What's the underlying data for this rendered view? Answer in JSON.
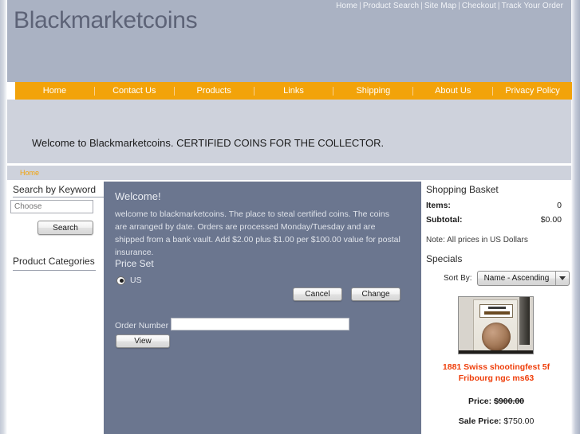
{
  "topnav": {
    "links": [
      "Home",
      "Product Search",
      "Site Map",
      "Checkout",
      "Track Your Order"
    ],
    "separator": "|"
  },
  "brand": {
    "title": "Blackmarketcoins"
  },
  "mainnav": {
    "items": [
      "Home",
      "Contact Us",
      "Products",
      "Links",
      "Shipping",
      "About Us",
      "Privacy Policy"
    ]
  },
  "banner": {
    "text": "Welcome to Blackmarketcoins. CERTIFIED COINS FOR THE COLLECTOR."
  },
  "breadcrumb": {
    "current": "Home"
  },
  "sidebar_left": {
    "search_heading": "Search by Keyword",
    "search_placeholder": "Choose",
    "search_value": "",
    "search_button": "Search",
    "categories_heading": "Product Categories"
  },
  "main": {
    "heading": "Welcome!",
    "body": "welcome to blackmarketcoins. The place to steal certified coins. The coins are arranged by date. Orders are processed Monday/Tuesday and are shipped from a bank vault. Add $2.00 plus $1.00 per $100.00 value for postal insurance.",
    "price_set_heading": "Price Set",
    "price_set_option": "US",
    "cancel_button": "Cancel",
    "change_button": "Change",
    "order_number_label": "Order Number",
    "order_number_value": "",
    "view_button": "View"
  },
  "sidebar_right": {
    "basket_heading": "Shopping Basket",
    "items_label": "Items:",
    "items_value": "0",
    "subtotal_label": "Subtotal:",
    "subtotal_value": "$0.00",
    "note": "Note: All prices in US Dollars",
    "specials_heading": "Specials",
    "sort_label": "Sort By:",
    "sort_value": "Name - Ascending",
    "special": {
      "name": "1881 Swiss shootingfest 5f Fribourg ngc ms63",
      "price_label": "Price:",
      "price_value": "$900.00",
      "sale_label": "Sale Price:",
      "sale_value": "$750.00"
    }
  },
  "colors": {
    "accent_orange": "#f2a30a",
    "masthead": "#aab2c3",
    "banner": "#ced2dc",
    "main_panel": "#6b768f",
    "special_name": "#ef3e0a"
  }
}
